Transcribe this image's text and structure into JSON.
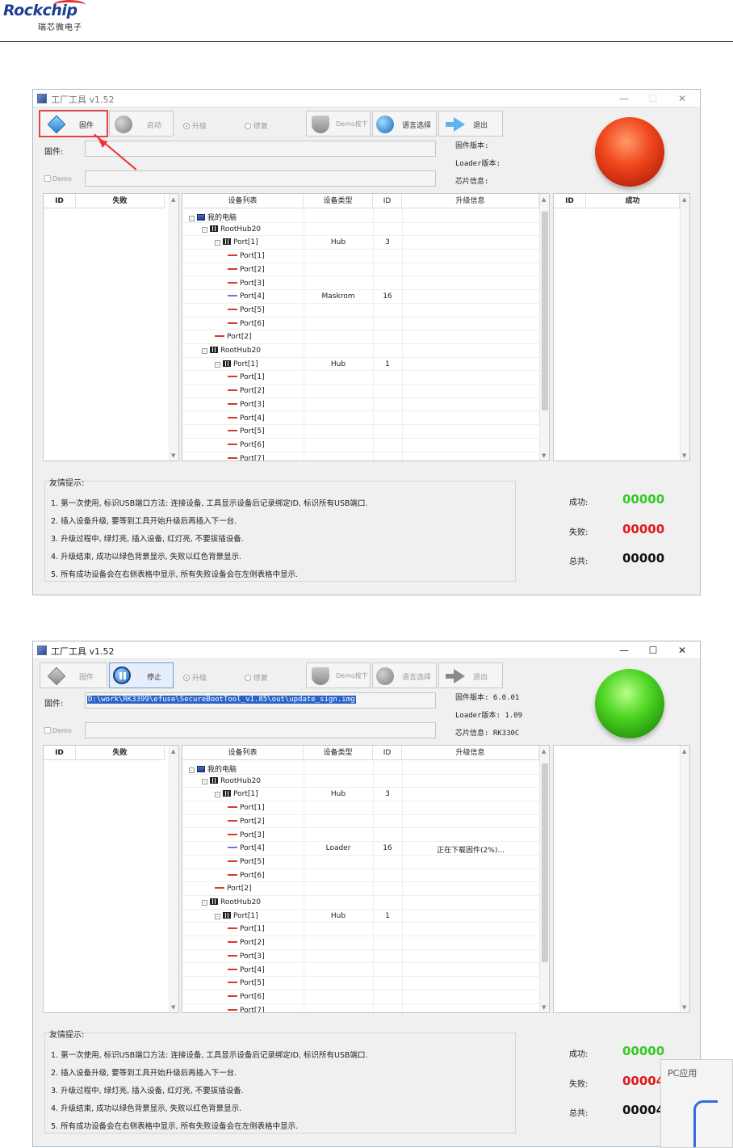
{
  "header": {
    "logo_text": "Rockchip",
    "logo_sub": "瑞芯微电子"
  },
  "windows": [
    {
      "title": "工厂工具 v1.52",
      "toolbar": {
        "firmware": "固件",
        "start": "启动",
        "upgrade": "升级",
        "repair": "修复",
        "demo": "Demo按下",
        "language": "语言选择",
        "exit": "退出"
      },
      "firmware_label": "固件:",
      "firmware_path": "",
      "demo_label": "Demo",
      "info": {
        "fw_version": "固件版本:",
        "loader_version": "Loader版本:",
        "chip_info": "芯片信息:"
      },
      "fail_table": {
        "col_id": "ID",
        "col_status": "失败"
      },
      "success_table": {
        "col_id": "ID",
        "col_status": "成功"
      },
      "tree_headers": {
        "device_list": "设备列表",
        "device_type": "设备类型",
        "id": "ID",
        "upgrade_info": "升级信息"
      },
      "tree": [
        {
          "name": "我的电脑",
          "indent": 0,
          "icon": "pc",
          "exp": "-",
          "type": "",
          "id": "",
          "info": ""
        },
        {
          "name": "RootHub20",
          "indent": 1,
          "icon": "hub",
          "exp": "-",
          "type": "",
          "id": "",
          "info": ""
        },
        {
          "name": "Port[1]",
          "indent": 2,
          "icon": "hub",
          "exp": "-",
          "type": "Hub",
          "id": "3",
          "info": ""
        },
        {
          "name": "Port[1]",
          "indent": 3,
          "icon": "usb",
          "type": "",
          "id": "",
          "info": ""
        },
        {
          "name": "Port[2]",
          "indent": 3,
          "icon": "usb",
          "type": "",
          "id": "",
          "info": ""
        },
        {
          "name": "Port[3]",
          "indent": 3,
          "icon": "usb",
          "type": "",
          "id": "",
          "info": ""
        },
        {
          "name": "Port[4]",
          "indent": 3,
          "icon": "usb-ok",
          "type": "Maskrom",
          "id": "16",
          "info": ""
        },
        {
          "name": "Port[5]",
          "indent": 3,
          "icon": "usb",
          "type": "",
          "id": "",
          "info": ""
        },
        {
          "name": "Port[6]",
          "indent": 3,
          "icon": "usb",
          "type": "",
          "id": "",
          "info": ""
        },
        {
          "name": "Port[2]",
          "indent": 2,
          "icon": "usb",
          "type": "",
          "id": "",
          "info": ""
        },
        {
          "name": "RootHub20",
          "indent": 1,
          "icon": "hub",
          "exp": "-",
          "type": "",
          "id": "",
          "info": ""
        },
        {
          "name": "Port[1]",
          "indent": 2,
          "icon": "hub",
          "exp": "-",
          "type": "Hub",
          "id": "1",
          "info": ""
        },
        {
          "name": "Port[1]",
          "indent": 3,
          "icon": "usb",
          "type": "",
          "id": "",
          "info": ""
        },
        {
          "name": "Port[2]",
          "indent": 3,
          "icon": "usb",
          "type": "",
          "id": "",
          "info": ""
        },
        {
          "name": "Port[3]",
          "indent": 3,
          "icon": "usb",
          "type": "",
          "id": "",
          "info": ""
        },
        {
          "name": "Port[4]",
          "indent": 3,
          "icon": "usb",
          "type": "",
          "id": "",
          "info": ""
        },
        {
          "name": "Port[5]",
          "indent": 3,
          "icon": "usb",
          "type": "",
          "id": "",
          "info": ""
        },
        {
          "name": "Port[6]",
          "indent": 3,
          "icon": "usb",
          "type": "",
          "id": "",
          "info": ""
        },
        {
          "name": "Port[7]",
          "indent": 3,
          "icon": "usb",
          "type": "",
          "id": "",
          "info": ""
        }
      ],
      "tips_label": "友情提示:",
      "tips": [
        "1. 第一次使用, 标识USB端口方法: 连接设备, 工具显示设备后记录绑定ID, 标识所有USB端口.",
        "2. 插入设备升级, 要等到工具开始升级后再插入下一台.",
        "3. 升级过程中, 绿灯亮, 插入设备, 红灯亮, 不要拔插设备.",
        "4. 升级结束, 成功以绿色背景显示, 失败以红色背景显示.",
        "5. 所有成功设备会在右侧表格中显示, 所有失败设备会在左侧表格中显示."
      ],
      "stats": {
        "success_label": "成功:",
        "success": "00000",
        "fail_label": "失败:",
        "fail": "00000",
        "total_label": "总共:",
        "total": "00000"
      }
    },
    {
      "title": "工厂工具 v1.52",
      "toolbar": {
        "firmware": "固件",
        "stop": "停止",
        "upgrade": "升级",
        "repair": "修复",
        "demo": "Demo按下",
        "language": "语言选择",
        "exit": "退出"
      },
      "firmware_label": "固件:",
      "firmware_path": "D:\\work\\RK3399\\efuse\\SecureBootTool_v1.85\\out\\update_sign.img",
      "demo_label": "Demo",
      "info": {
        "fw_version": "固件版本: 6.0.01",
        "loader_version": "Loader版本: 1.09",
        "chip_info": "芯片信息: RK330C"
      },
      "fail_table": {
        "col_id": "ID",
        "col_status": "失败"
      },
      "tree_headers": {
        "device_list": "设备列表",
        "device_type": "设备类型",
        "id": "ID",
        "upgrade_info": "升级信息"
      },
      "tree": [
        {
          "name": "我的电脑",
          "indent": 0,
          "icon": "pc",
          "exp": "-",
          "type": "",
          "id": "",
          "info": ""
        },
        {
          "name": "RootHub20",
          "indent": 1,
          "icon": "hub",
          "exp": "-",
          "type": "",
          "id": "",
          "info": ""
        },
        {
          "name": "Port[1]",
          "indent": 2,
          "icon": "hub",
          "exp": "-",
          "type": "Hub",
          "id": "3",
          "info": ""
        },
        {
          "name": "Port[1]",
          "indent": 3,
          "icon": "usb",
          "type": "",
          "id": "",
          "info": ""
        },
        {
          "name": "Port[2]",
          "indent": 3,
          "icon": "usb",
          "type": "",
          "id": "",
          "info": ""
        },
        {
          "name": "Port[3]",
          "indent": 3,
          "icon": "usb",
          "type": "",
          "id": "",
          "info": ""
        },
        {
          "name": "Port[4]",
          "indent": 3,
          "icon": "usb-ok",
          "type": "Loader",
          "id": "16",
          "info": "正在下载固件(2%)..."
        },
        {
          "name": "Port[5]",
          "indent": 3,
          "icon": "usb",
          "type": "",
          "id": "",
          "info": ""
        },
        {
          "name": "Port[6]",
          "indent": 3,
          "icon": "usb",
          "type": "",
          "id": "",
          "info": ""
        },
        {
          "name": "Port[2]",
          "indent": 2,
          "icon": "usb",
          "type": "",
          "id": "",
          "info": ""
        },
        {
          "name": "RootHub20",
          "indent": 1,
          "icon": "hub",
          "exp": "-",
          "type": "",
          "id": "",
          "info": ""
        },
        {
          "name": "Port[1]",
          "indent": 2,
          "icon": "hub",
          "exp": "-",
          "type": "Hub",
          "id": "1",
          "info": ""
        },
        {
          "name": "Port[1]",
          "indent": 3,
          "icon": "usb",
          "type": "",
          "id": "",
          "info": ""
        },
        {
          "name": "Port[2]",
          "indent": 3,
          "icon": "usb",
          "type": "",
          "id": "",
          "info": ""
        },
        {
          "name": "Port[3]",
          "indent": 3,
          "icon": "usb",
          "type": "",
          "id": "",
          "info": ""
        },
        {
          "name": "Port[4]",
          "indent": 3,
          "icon": "usb",
          "type": "",
          "id": "",
          "info": ""
        },
        {
          "name": "Port[5]",
          "indent": 3,
          "icon": "usb",
          "type": "",
          "id": "",
          "info": ""
        },
        {
          "name": "Port[6]",
          "indent": 3,
          "icon": "usb",
          "type": "",
          "id": "",
          "info": ""
        },
        {
          "name": "Port[7]",
          "indent": 3,
          "icon": "usb",
          "type": "",
          "id": "",
          "info": ""
        }
      ],
      "tips_label": "友情提示:",
      "tips": [
        "1. 第一次使用, 标识USB端口方法: 连接设备, 工具显示设备后记录绑定ID, 标识所有USB端口.",
        "2. 插入设备升级, 要等到工具开始升级后再插入下一台.",
        "3. 升级过程中, 绿灯亮, 插入设备, 红灯亮, 不要拔插设备.",
        "4. 升级结束, 成功以绿色背景显示, 失败以红色背景显示.",
        "5. 所有成功设备会在右侧表格中显示, 所有失败设备会在左侧表格中显示."
      ],
      "stats": {
        "success_label": "成功:",
        "success": "00000",
        "fail_label": "失败:",
        "fail": "00004",
        "total_label": "总共:",
        "total": "00004"
      }
    }
  ],
  "popup": {
    "text": "PC应用"
  },
  "colors": {
    "success_green": "#35c923",
    "fail_red": "#e0181b",
    "logo_blue": "#1f3f94"
  }
}
